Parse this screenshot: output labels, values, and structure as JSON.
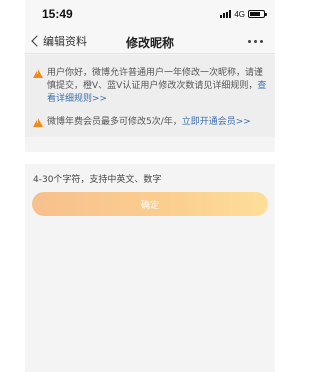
{
  "status_bar": {
    "time": "15:49",
    "network": "4G"
  },
  "nav": {
    "back_label": "编辑资料",
    "title": "修改昵称",
    "more_icon": "more-dots-icon"
  },
  "notice": {
    "line1_text": "用户你好，微博允许普通用户一年修改一次昵称，请谨慎提交，橙V、蓝V认证用户修改次数请见详细规则，",
    "line1_link": "查看详细规则>>",
    "line2_text": "微博年费会员最多可修改5次/年，",
    "line2_link": "立即开通会员>>"
  },
  "form": {
    "nickname_value": "",
    "hint": "4-30个字符，支持中英文、数字",
    "confirm_label": "确定"
  },
  "colors": {
    "warning": "#f08a1c",
    "link": "#3d6fb0",
    "button_gradient_start": "#f7c08d",
    "button_gradient_end": "#fddf9a"
  }
}
